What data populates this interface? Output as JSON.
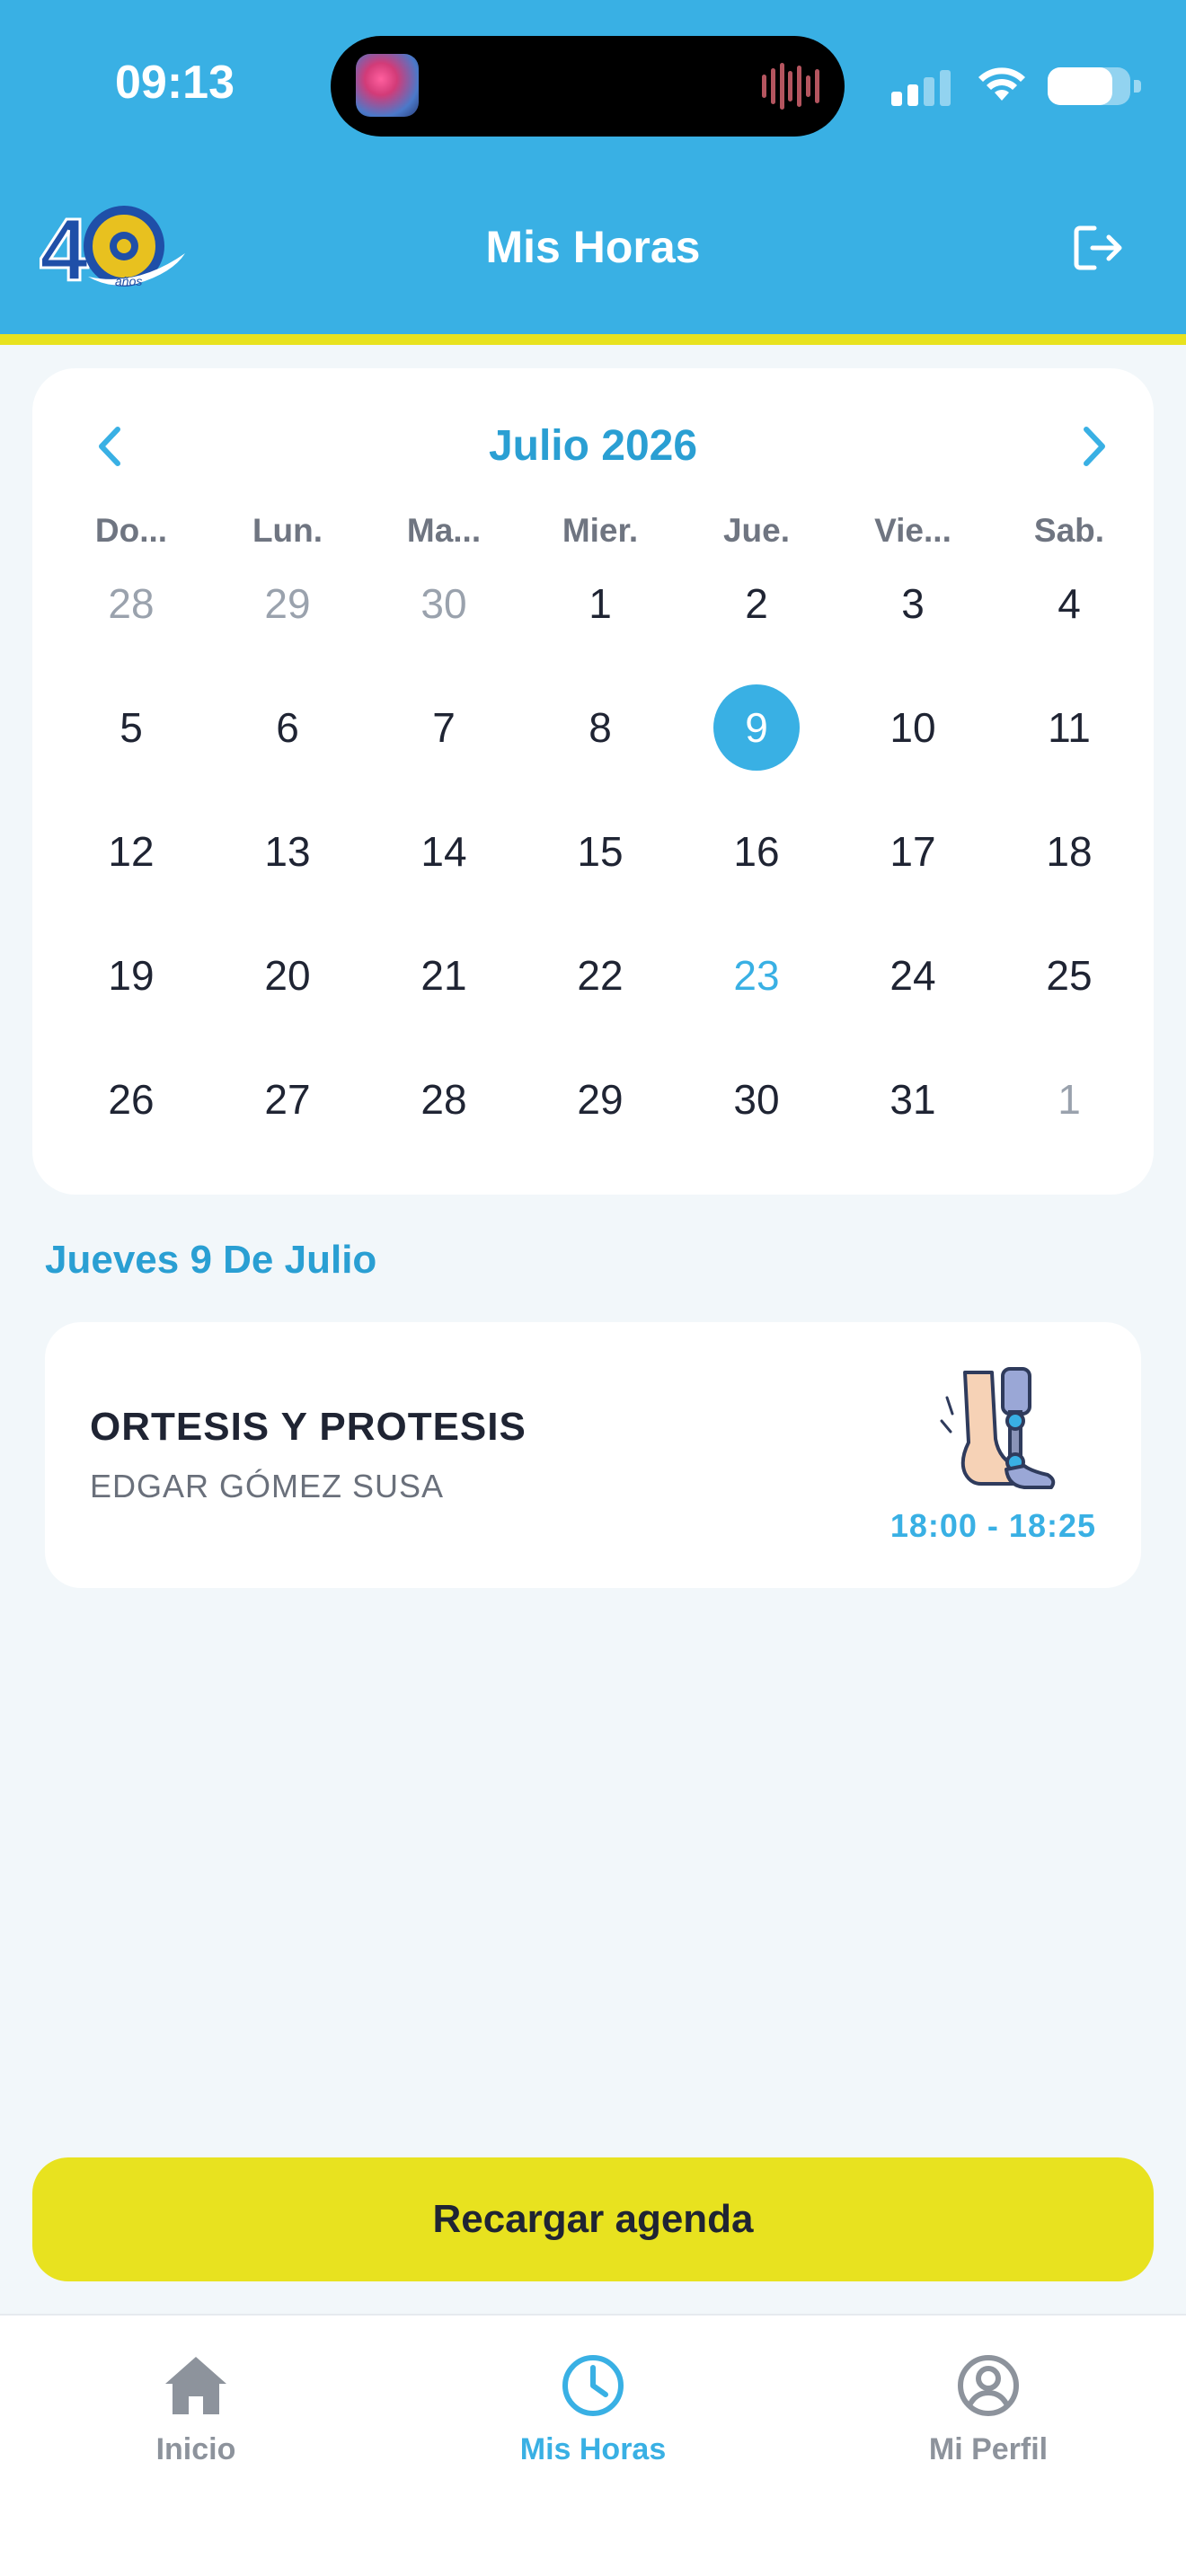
{
  "status_bar": {
    "time": "09:13"
  },
  "header": {
    "title": "Mis Horas"
  },
  "calendar": {
    "month_label": "Julio 2026",
    "weekdays": [
      "Do...",
      "Lun.",
      "Ma...",
      "Mier.",
      "Jue.",
      "Vie...",
      "Sab."
    ],
    "weeks": [
      [
        "28",
        "29",
        "30",
        "1",
        "2",
        "3",
        "4"
      ],
      [
        "5",
        "6",
        "7",
        "8",
        "9",
        "10",
        "11"
      ],
      [
        "12",
        "13",
        "14",
        "15",
        "16",
        "17",
        "18"
      ],
      [
        "19",
        "20",
        "21",
        "22",
        "23",
        "24",
        "25"
      ],
      [
        "26",
        "27",
        "28",
        "29",
        "30",
        "31",
        "1"
      ]
    ],
    "selected_day": "9",
    "marked_days": [
      "23"
    ]
  },
  "selected_date_label": "Jueves 9 De Julio",
  "appointment": {
    "title": "ORTESIS Y PROTESIS",
    "professional": "EDGAR GÓMEZ SUSA",
    "time": "18:00 - 18:25"
  },
  "reload_button": {
    "label": "Recargar agenda"
  },
  "tabs": [
    {
      "label": "Inicio",
      "icon": "home-icon"
    },
    {
      "label": "Mis Horas",
      "icon": "clock-icon"
    },
    {
      "label": "Mi Perfil",
      "icon": "profile-icon"
    }
  ],
  "colors": {
    "accent": "#39b0e4",
    "highlight": "#e8e21f",
    "background": "#f2f7fa"
  }
}
